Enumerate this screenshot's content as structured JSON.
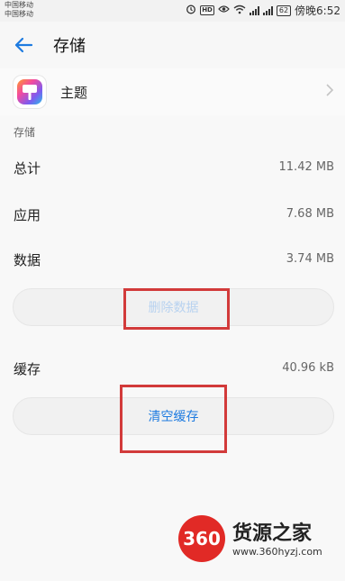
{
  "status_bar": {
    "carrier_1": "中国移动",
    "carrier_2": "中国移动",
    "battery": "62",
    "time": "傍晚6:52"
  },
  "header": {
    "title": "存储"
  },
  "app": {
    "name": "主题"
  },
  "storage": {
    "section_label": "存储",
    "total_label": "总计",
    "total_value": "11.42 MB",
    "app_label": "应用",
    "app_value": "7.68 MB",
    "data_label": "数据",
    "data_value": "3.74 MB",
    "clear_data_label": "删除数据"
  },
  "cache": {
    "label": "缓存",
    "value": "40.96 kB",
    "clear_cache_label": "清空缓存"
  },
  "watermark": {
    "logo_text": "360",
    "brand": "货源之家",
    "url": "www.360hyzj.com"
  },
  "colors": {
    "accent": "#1e7be0",
    "highlight": "#d23a3a",
    "watermark_red": "#e12a26"
  }
}
